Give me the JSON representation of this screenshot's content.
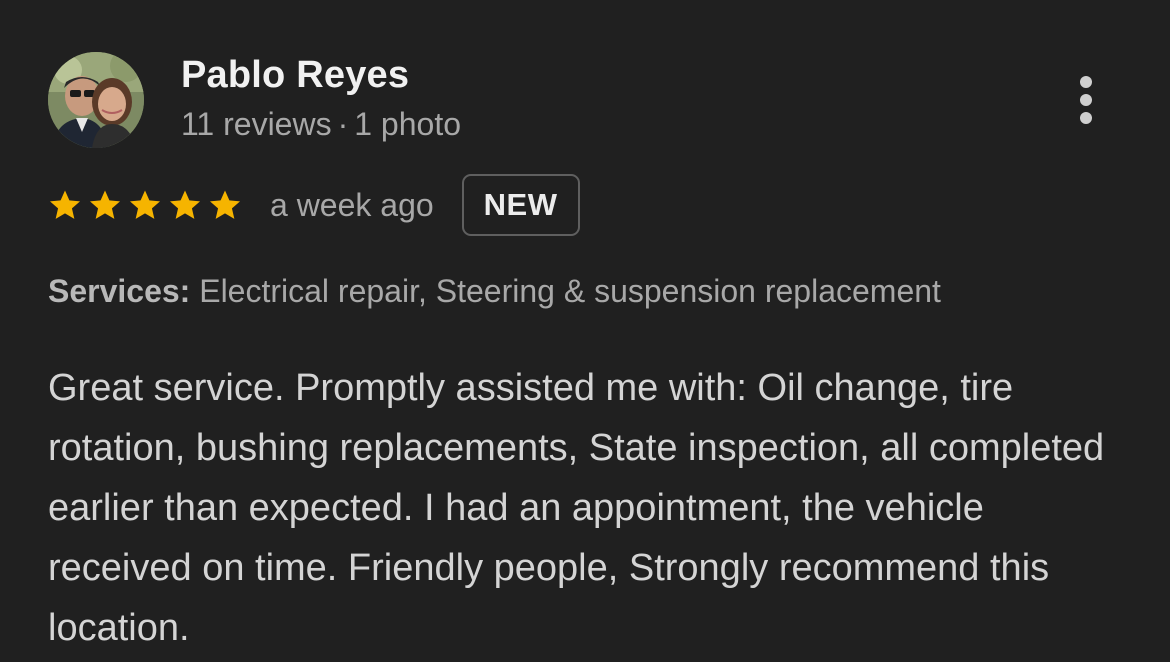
{
  "review": {
    "author": {
      "name": "Pablo Reyes",
      "reviews": "11 reviews",
      "separator": "·",
      "photos": "1 photo"
    },
    "rating": 5,
    "max_rating": 5,
    "star_color": "#f6b400",
    "date": "a week ago",
    "badge": "NEW",
    "services": {
      "label": "Services:",
      "value": "Electrical repair, Steering & suspension replacement"
    },
    "text": "Great service. Promptly assisted me with: Oil change, tire rotation, bushing replacements, State inspection, all completed earlier than expected. I had an appointment, the vehicle received on time. Friendly people, Strongly recommend this location.",
    "menu_icon": "more-vert-icon",
    "avatar_icon": "profile-photo"
  }
}
